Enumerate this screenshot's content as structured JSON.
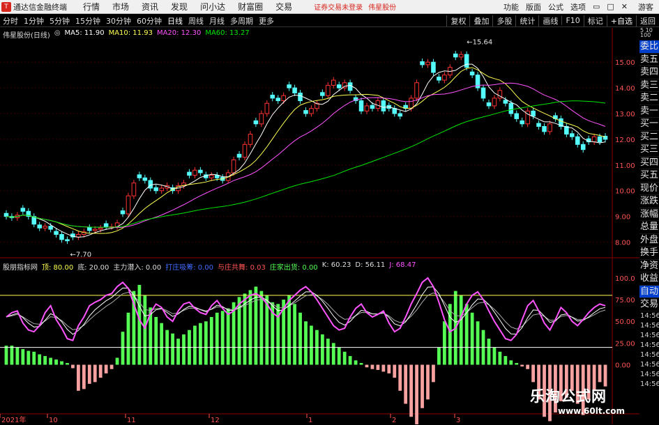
{
  "app": {
    "title": "通达信金融终端",
    "menus": [
      "行情",
      "市场",
      "资讯",
      "发现",
      "问小达",
      "财富圈",
      "交易"
    ],
    "notice": "证券交易未登录",
    "stock_notice": "伟星股份",
    "right_menus": [
      "功能",
      "版面",
      "公式",
      "选项"
    ],
    "user": "游客"
  },
  "toolbar": {
    "periods": [
      "分时",
      "1分钟",
      "5分钟",
      "15分钟",
      "30分钟",
      "60分钟",
      "日线",
      "周线",
      "月线",
      "多周期",
      "更多"
    ],
    "active": "日线",
    "right_buttons": [
      "复权",
      "叠加",
      "多股",
      "统计",
      "画线",
      "F10",
      "标记",
      "+自选",
      "返回"
    ]
  },
  "stock": {
    "name": "伟星股份(日线)",
    "ma5": "MA5: 11.90",
    "ma10": "MA10: 11.93",
    "ma20": "MA20: 12.30",
    "ma60": "MA60: 13.27"
  },
  "indicator": {
    "name": "股朋指标网",
    "top": "顶: 80.00",
    "bottom": "底: 20.00",
    "zljr": "主力潜入: 0.00",
    "dzsl": "打庄吸筹: 0.00",
    "yzgw": "与庄共舞: 0.03",
    "zjcd": "庄家出货: 0.00",
    "k": "K: 60.23",
    "d": "D: 56.11",
    "j": "J: 68.47"
  },
  "right_panel": {
    "top_labels": [
      "委比",
      "卖五",
      "卖四",
      "卖三",
      "卖二",
      "卖一",
      "买一",
      "买二",
      "买三",
      "买四",
      "买五",
      "现价",
      "涨跌",
      "涨幅",
      "总量",
      "外盘",
      "换手",
      "净资",
      "收益"
    ],
    "bottom_labels": [
      "自动",
      "交易",
      "14:56",
      "14:56",
      "14:56",
      "14:56",
      "14:56",
      "14:56",
      "14:56",
      "14:56"
    ],
    "ruler": "5\n10\n100"
  },
  "watermark": {
    "text": "乐淘公式网",
    "url": "www.60lt.com"
  },
  "colors": {
    "up": "#ff3232",
    "down": "#54fcfc",
    "ma5": "#ffffff",
    "ma10": "#ffff54",
    "ma20": "#ff54ff",
    "ma60": "#00e600",
    "notice": "#d7261e",
    "selected_tab": "#003ecc"
  },
  "chart_data": {
    "type": "candlestick",
    "price_axis": {
      "ticks": [
        8.0,
        9.0,
        10.0,
        11.0,
        12.0,
        13.0,
        14.0,
        15.0
      ],
      "labels": [
        "8.00",
        "9.00",
        "10.00",
        "11.00",
        "12.00",
        "13.00",
        "14.00",
        "15.00"
      ],
      "range": [
        7.5,
        15.9
      ]
    },
    "annotations": {
      "high": "15.64",
      "high_value": 15.64,
      "low": "7.70",
      "low_value": 7.7
    },
    "date_labels": [
      "2021年",
      "10",
      "11",
      "12",
      "1",
      "2",
      "3"
    ],
    "ma_series": [
      "MA5",
      "MA10",
      "MA20",
      "MA60"
    ],
    "closes": [
      9.0,
      8.95,
      9.05,
      9.2,
      9.0,
      8.7,
      8.55,
      8.62,
      8.5,
      8.3,
      8.1,
      8.05,
      8.2,
      8.3,
      8.4,
      8.45,
      8.5,
      8.55,
      8.6,
      8.6,
      8.75,
      9.1,
      9.8,
      10.3,
      10.5,
      10.4,
      10.1,
      10.0,
      10.1,
      10.2,
      10.0,
      10.2,
      10.3,
      10.6,
      10.8,
      10.7,
      10.5,
      10.6,
      10.5,
      10.4,
      10.7,
      11.2,
      11.3,
      11.8,
      12.2,
      12.6,
      13.0,
      13.4,
      13.6,
      13.5,
      13.7,
      14.0,
      13.8,
      13.5,
      13.0,
      13.2,
      13.4,
      13.7,
      14.1,
      14.3,
      14.0,
      14.2,
      13.9,
      13.5,
      13.1,
      13.3,
      13.2,
      13.5,
      13.1,
      13.2,
      13.0,
      12.9,
      13.2,
      13.6,
      14.2,
      14.9,
      15.0,
      14.6,
      14.3,
      14.5,
      14.8,
      15.2,
      15.3,
      14.8,
      14.5,
      14.0,
      13.6,
      13.3,
      13.6,
      13.9,
      13.4,
      13.0,
      12.8,
      12.6,
      13.1,
      12.9,
      12.5,
      12.3,
      12.6,
      12.8,
      12.5,
      12.2,
      12.1,
      11.8,
      11.6,
      11.9,
      12.1,
      11.9,
      12.0
    ],
    "ohlc_open_offset": 0.12,
    "kdj_axis": {
      "ticks": [
        0,
        25,
        50,
        75,
        100
      ],
      "labels": [
        "0.00",
        "25.00",
        "50.00",
        "75.00",
        "100.0"
      ],
      "range": [
        -55,
        112
      ]
    },
    "top_line": 80,
    "bottom_line": 20,
    "kdj_j": [
      55,
      60,
      62,
      48,
      40,
      38,
      45,
      60,
      68,
      52,
      42,
      30,
      28,
      45,
      55,
      68,
      72,
      75,
      80,
      82,
      90,
      95,
      88,
      70,
      52,
      42,
      60,
      70,
      66,
      55,
      50,
      62,
      70,
      72,
      65,
      60,
      58,
      68,
      74,
      65,
      58,
      62,
      70,
      75,
      80,
      82,
      78,
      70,
      60,
      55,
      65,
      74,
      80,
      86,
      90,
      84,
      75,
      65,
      55,
      45,
      40,
      42,
      55,
      65,
      70,
      60,
      55,
      58,
      62,
      48,
      38,
      42,
      55,
      70,
      82,
      95,
      100,
      90,
      72,
      52,
      38,
      42,
      55,
      70,
      80,
      84,
      75,
      62,
      50,
      40,
      30,
      28,
      35,
      52,
      68,
      74,
      62,
      48,
      40,
      52,
      66,
      60,
      50,
      45,
      52,
      60,
      66,
      70,
      68
    ],
    "bars": [
      22,
      22,
      20,
      18,
      16,
      15,
      12,
      10,
      8,
      6,
      4,
      2,
      -4,
      -30,
      -28,
      -22,
      -20,
      -15,
      -10,
      -5,
      8,
      38,
      60,
      85,
      92,
      80,
      66,
      55,
      48,
      40,
      36,
      30,
      35,
      40,
      45,
      48,
      50,
      55,
      60,
      62,
      65,
      72,
      78,
      82,
      86,
      90,
      85,
      80,
      72,
      70,
      75,
      80,
      70,
      60,
      50,
      45,
      40,
      35,
      30,
      25,
      20,
      15,
      10,
      5,
      2,
      -3,
      -5,
      -6,
      -8,
      -10,
      -15,
      -30,
      -45,
      -60,
      -70,
      -50,
      -40,
      -20,
      20,
      50,
      70,
      85,
      80,
      70,
      60,
      50,
      40,
      30,
      20,
      15,
      10,
      5,
      2,
      -2,
      -5,
      -20,
      -40,
      -60,
      -65,
      -55,
      -42,
      -38,
      -30,
      -45,
      -58,
      -40,
      -30,
      -20,
      -25
    ]
  }
}
